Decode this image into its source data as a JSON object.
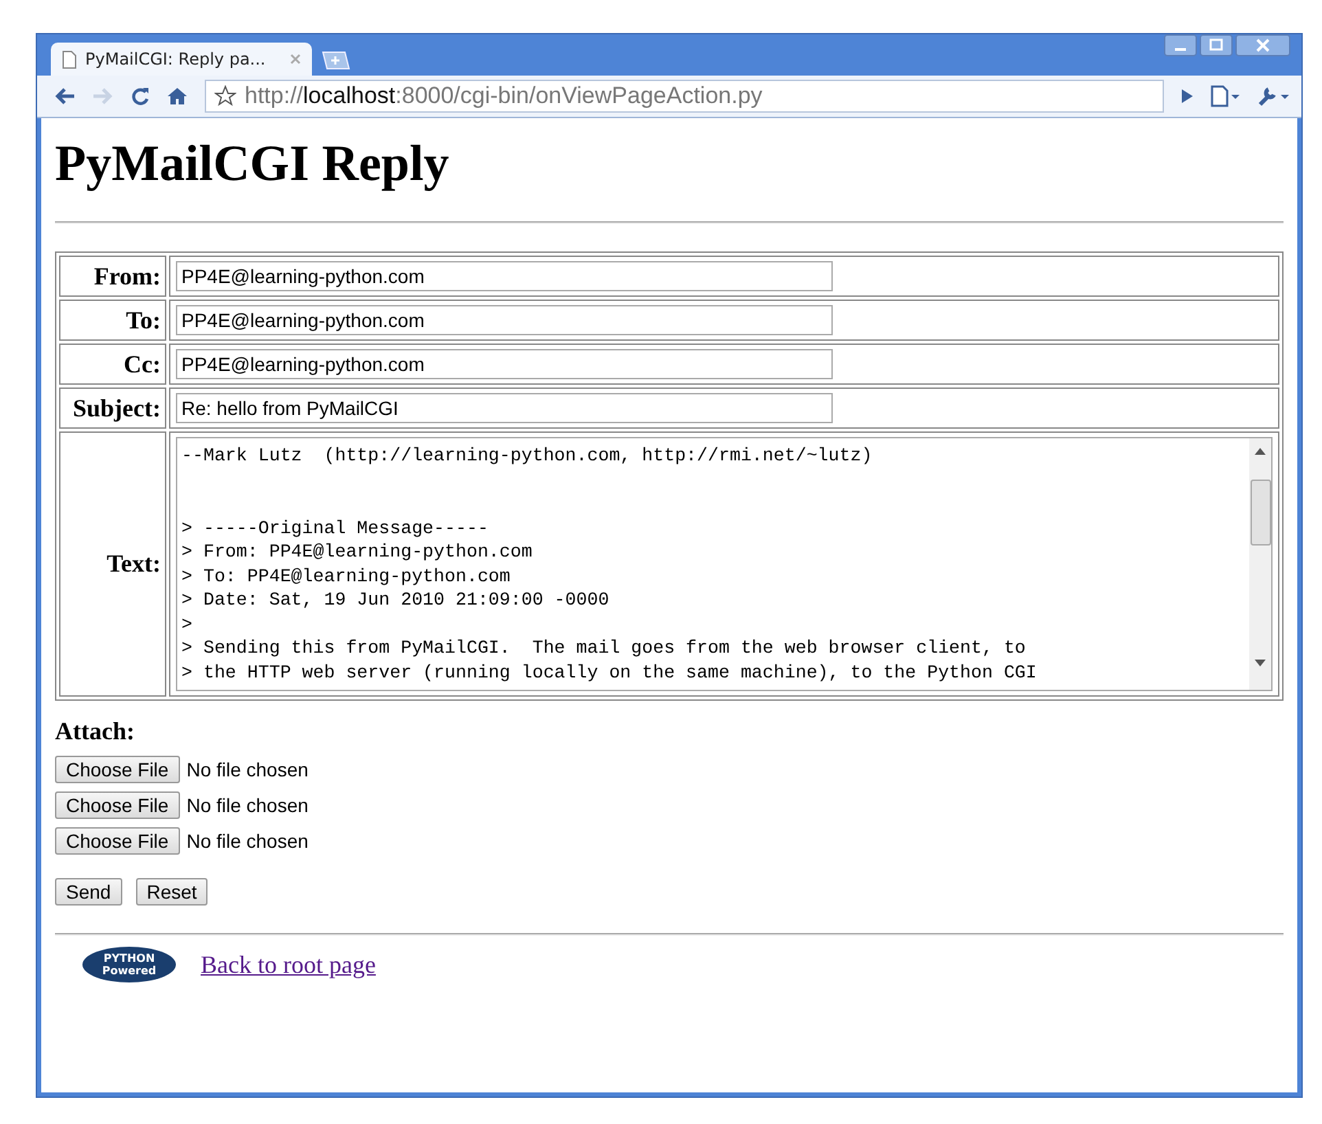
{
  "browser": {
    "tab_title": "PyMailCGI: Reply pa...",
    "url_scheme": "http://",
    "url_host": "localhost",
    "url_rest": ":8000/cgi-bin/onViewPageAction.py"
  },
  "page": {
    "heading": "PyMailCGI Reply",
    "fields": [
      {
        "label": "From:",
        "value": "PP4E@learning-python.com"
      },
      {
        "label": "To:",
        "value": "PP4E@learning-python.com"
      },
      {
        "label": "Cc:",
        "value": "PP4E@learning-python.com"
      },
      {
        "label": "Subject:",
        "value": "Re: hello from PyMailCGI"
      }
    ],
    "text_label": "Text:",
    "text_lines": [
      "--Mark Lutz  (http://learning-python.com, http://rmi.net/~lutz)\n\n",
      "> -----Original Message-----",
      "> From: PP4E@learning-python.com",
      "> To: PP4E@learning-python.com",
      "> Date: Sat, 19 Jun 2010 21:09:00 -0000",
      ">",
      "> Sending this from PyMailCGI.  The mail goes from the web browser client, to",
      "> the HTTP web server (running locally on the same machine), to the Python CGI"
    ],
    "attach_label": "Attach:",
    "attachments": [
      {
        "button": "Choose File",
        "status": "No file chosen"
      },
      {
        "button": "Choose File",
        "status": "No file chosen"
      },
      {
        "button": "Choose File",
        "status": "No file chosen"
      }
    ],
    "buttons": [
      "Send",
      "Reset"
    ],
    "logo_text": [
      "PYTHON",
      "Powered"
    ],
    "link": "Back to root page"
  }
}
